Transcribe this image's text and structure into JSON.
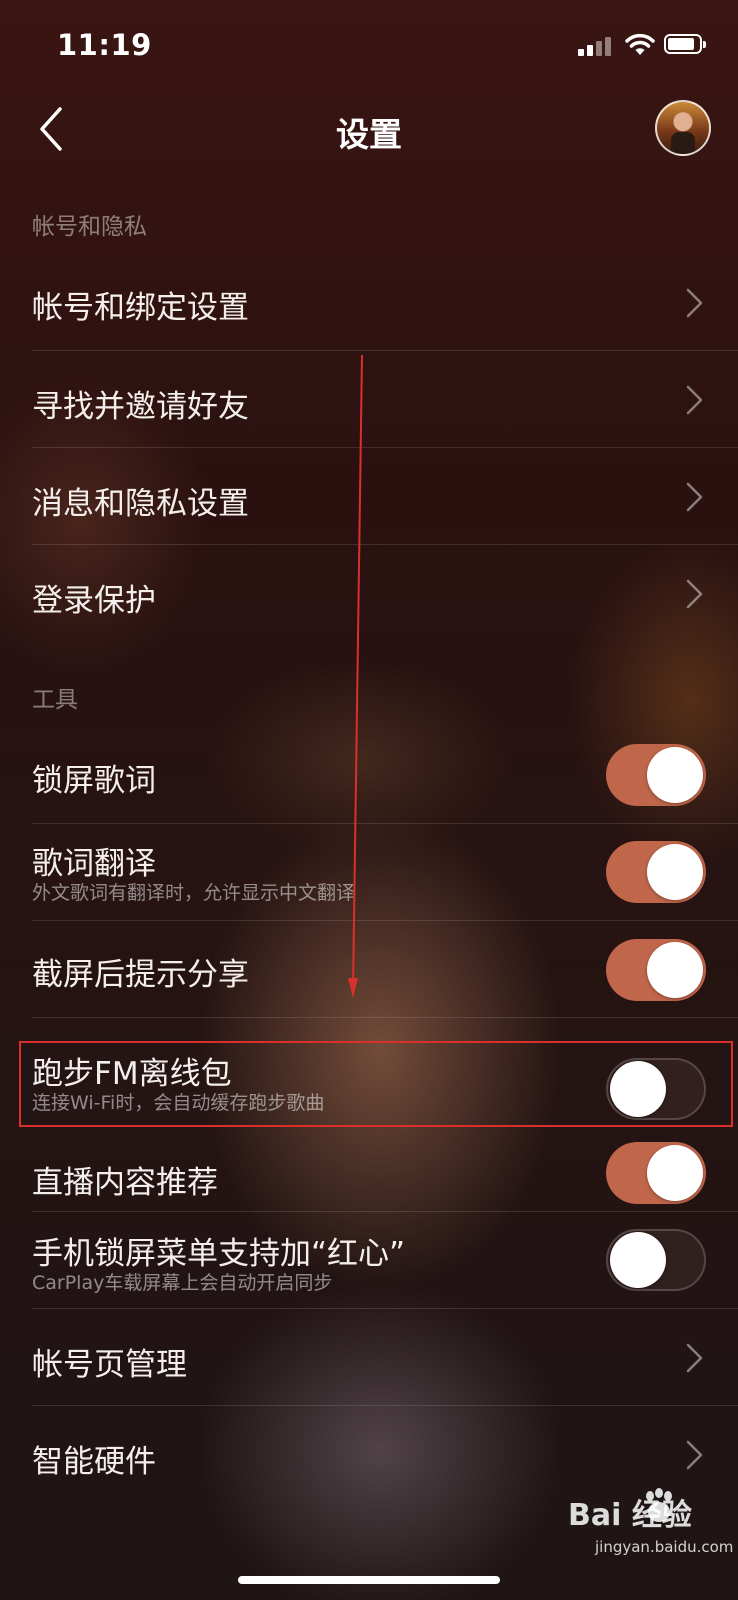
{
  "status_bar": {
    "time": "11:19"
  },
  "header": {
    "title": "设置"
  },
  "sections": {
    "account": {
      "title": "帐号和隐私"
    },
    "tools": {
      "title": "工具"
    }
  },
  "rows": [
    {
      "label": "帐号和绑定设置",
      "type": "link"
    },
    {
      "label": "寻找并邀请好友",
      "type": "link"
    },
    {
      "label": "消息和隐私设置",
      "type": "link"
    },
    {
      "label": "登录保护",
      "type": "link"
    },
    {
      "label": "锁屏歌词",
      "type": "toggle",
      "on": true
    },
    {
      "label": "歌词翻译",
      "subtitle": "外文歌词有翻译时，允许显示中文翻译",
      "type": "toggle",
      "on": true
    },
    {
      "label": "截屏后提示分享",
      "type": "toggle",
      "on": true
    },
    {
      "label": "跑步FM离线包",
      "subtitle": "连接Wi-Fi时，会自动缓存跑步歌曲",
      "type": "toggle",
      "on": false
    },
    {
      "label": "直播内容推荐",
      "type": "toggle",
      "on": true
    },
    {
      "label": "手机锁屏菜单支持加“红心”",
      "subtitle": "CarPlay车载屏幕上会自动开启同步",
      "type": "toggle",
      "on": false
    },
    {
      "label": "帐号页管理",
      "type": "link"
    },
    {
      "label": "智能硬件",
      "type": "link"
    }
  ],
  "watermark": {
    "brand": "Bai  经验",
    "site": "jingyan.baidu.com"
  },
  "colors": {
    "toggle_on": "#c0664a",
    "highlight": "#d9302c"
  }
}
